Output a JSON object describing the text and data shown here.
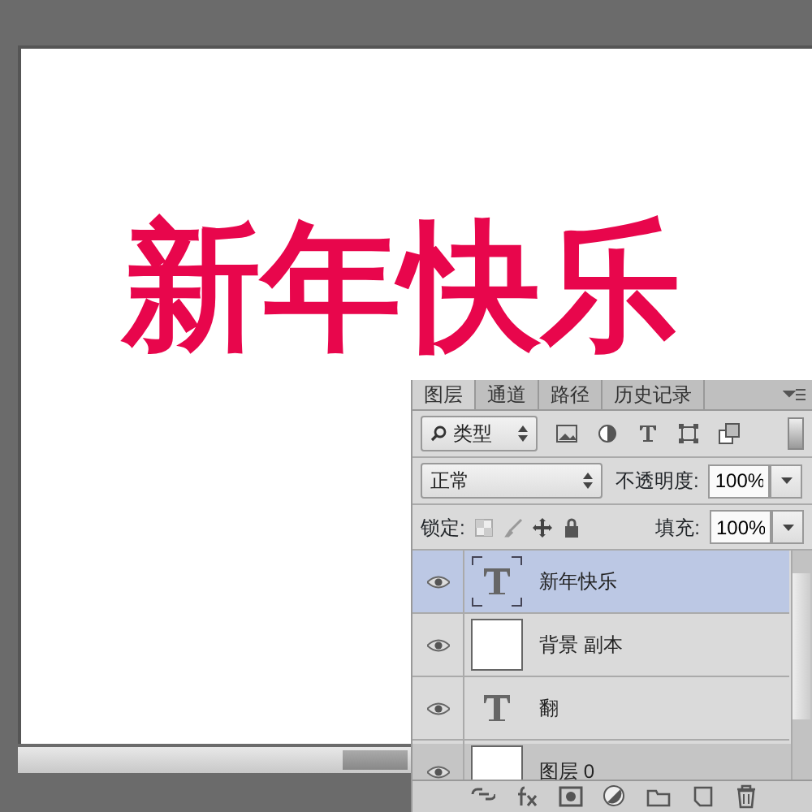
{
  "canvas": {
    "text": "新年快乐"
  },
  "panel": {
    "tabs": [
      {
        "label": "图层",
        "selected": true
      },
      {
        "label": "通道",
        "selected": false
      },
      {
        "label": "路径",
        "selected": false
      },
      {
        "label": "历史记录",
        "selected": false
      }
    ],
    "filter": {
      "value": "类型"
    },
    "blend": {
      "mode": "正常",
      "opacity_label": "不透明度:",
      "opacity": "100%"
    },
    "lock": {
      "label": "锁定:",
      "fill_label": "填充:",
      "fill": "100%"
    },
    "layers": [
      {
        "name": "新年快乐",
        "kind": "text",
        "visible": true,
        "selected": true
      },
      {
        "name": "背景 副本",
        "kind": "pixel",
        "visible": true,
        "selected": false
      },
      {
        "name": "翻",
        "kind": "text",
        "visible": true,
        "selected": false
      },
      {
        "name": "图层 0",
        "kind": "pixel",
        "visible": true,
        "selected": false
      }
    ]
  }
}
